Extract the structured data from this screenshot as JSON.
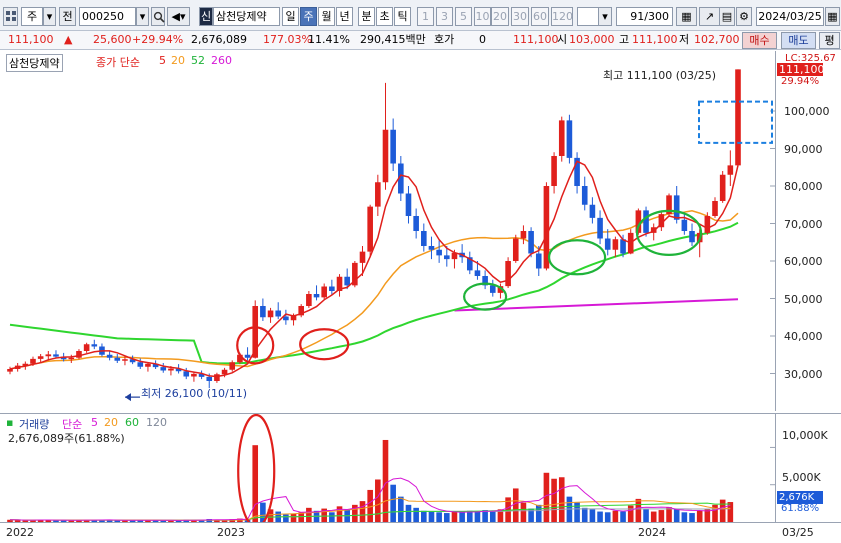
{
  "toolbar": {
    "period_mode": "주",
    "all_mark": "전",
    "code": "000250",
    "code_badge": "신",
    "stock_name": "삼천당제약",
    "intervals": [
      "일",
      "주",
      "월",
      "년",
      "분",
      "초",
      "틱"
    ],
    "selected_interval": "주",
    "ticks": [
      "1",
      "3",
      "5",
      "10",
      "20",
      "30",
      "60",
      "120"
    ],
    "count": "91",
    "total": "/300",
    "date": "2024/03/25"
  },
  "info": {
    "price": "111,100",
    "change": "25,600",
    "change_pct": "+29.94%",
    "volume": "2,676,089",
    "volume_ratio": "177.03%",
    "turnover": "11.41%",
    "amount": "290,415백만",
    "quote_label": "호가",
    "quote_value": "0",
    "last": "111,100",
    "open_label": "시",
    "open": "103,000",
    "high_label": "고",
    "high": "111,100",
    "low_label": "저",
    "low": "102,700",
    "buy_label": "매수",
    "sell_label": "매도",
    "eval_label": "평"
  },
  "price_panel": {
    "title": "삼천당제약",
    "ma_label": "종가 단순",
    "ma_periods": [
      "5",
      "20",
      "52",
      "260"
    ],
    "ma_colors": [
      "#e0201c",
      "#f39a1e",
      "#2fd62f",
      "#d619d6"
    ],
    "lc_label": "LC:325.67",
    "last_price_tag": "111,100",
    "last_pct_tag": "29.94%",
    "high_note": "최고 111,100 (03/25)",
    "low_note": "최저 26,100 (10/11)",
    "y_ticks": [
      "100,000",
      "90,000",
      "80,000",
      "70,000",
      "60,000",
      "50,000",
      "40,000",
      "30,000"
    ]
  },
  "volume_panel": {
    "title": "거래량",
    "ma_label": "단순",
    "ma_periods": [
      "5",
      "20",
      "60",
      "120"
    ],
    "ma_colors": [
      "#d619d6",
      "#f39a1e",
      "#2fd62f",
      "#9aa3b3"
    ],
    "value_label": "2,676,089주(61.88%)",
    "y_ticks": [
      "10,000K",
      "5,000K"
    ],
    "tag_value": "2,676K",
    "tag_pct": "61.88%"
  },
  "x_axis": {
    "labels": [
      "2022",
      "2023",
      "2024"
    ],
    "current": "03/25"
  },
  "colors": {
    "up": "#e0201c",
    "down": "#1d5bd8",
    "annotation_red": "#e0201c",
    "annotation_green": "#1fb33a",
    "annotation_blue": "#1b7fe0"
  },
  "chart_data": {
    "type": "candlestick",
    "title": "삼천당제약",
    "interval": "weekly",
    "x_labels": [
      "2022",
      "2023",
      "2024"
    ],
    "ylim": [
      24000,
      112000
    ],
    "y_ticks": [
      30000,
      40000,
      50000,
      60000,
      70000,
      80000,
      90000,
      100000
    ],
    "ohlc": [
      [
        30500,
        31800,
        29800,
        31200
      ],
      [
        31200,
        32800,
        30500,
        32100
      ],
      [
        32100,
        33200,
        31000,
        32600
      ],
      [
        32600,
        34500,
        32000,
        33900
      ],
      [
        33900,
        35200,
        33000,
        34600
      ],
      [
        34600,
        36000,
        33500,
        35100
      ],
      [
        35100,
        36200,
        34000,
        34500
      ],
      [
        34500,
        35500,
        33200,
        33800
      ],
      [
        33800,
        35000,
        32800,
        34200
      ],
      [
        34200,
        36500,
        33800,
        36000
      ],
      [
        36000,
        38200,
        35500,
        37800
      ],
      [
        37800,
        39000,
        36500,
        37200
      ],
      [
        37200,
        38000,
        34500,
        35000
      ],
      [
        35000,
        36000,
        33500,
        34200
      ],
      [
        34200,
        35200,
        32800,
        33400
      ],
      [
        33400,
        34500,
        32200,
        33800
      ],
      [
        33800,
        34800,
        32500,
        33000
      ],
      [
        33000,
        34000,
        31200,
        31800
      ],
      [
        31800,
        33000,
        30500,
        32600
      ],
      [
        32600,
        33500,
        31200,
        31700
      ],
      [
        31700,
        32800,
        30200,
        30800
      ],
      [
        30800,
        32000,
        29500,
        31300
      ],
      [
        31300,
        32500,
        30000,
        30600
      ],
      [
        30600,
        31500,
        28500,
        29200
      ],
      [
        29200,
        30500,
        27800,
        29900
      ],
      [
        29900,
        30800,
        28500,
        29100
      ],
      [
        29100,
        30000,
        26100,
        28000
      ],
      [
        28000,
        30200,
        27500,
        29800
      ],
      [
        29800,
        31500,
        29000,
        31000
      ],
      [
        31000,
        33500,
        30500,
        33000
      ],
      [
        33000,
        35500,
        32500,
        35000
      ],
      [
        35000,
        37000,
        33500,
        34200
      ],
      [
        34200,
        49500,
        34000,
        48000
      ],
      [
        48000,
        50000,
        44000,
        45000
      ],
      [
        45000,
        47500,
        43500,
        46800
      ],
      [
        46800,
        49000,
        44500,
        45200
      ],
      [
        45200,
        47000,
        43000,
        44200
      ],
      [
        44200,
        46000,
        42800,
        45500
      ],
      [
        45500,
        48500,
        45000,
        48000
      ],
      [
        48000,
        52000,
        47500,
        51200
      ],
      [
        51200,
        53500,
        49500,
        50300
      ],
      [
        50300,
        54000,
        49800,
        53200
      ],
      [
        53200,
        55000,
        51000,
        52000
      ],
      [
        52000,
        56500,
        50500,
        55800
      ],
      [
        55800,
        58000,
        52500,
        53500
      ],
      [
        53500,
        60000,
        53000,
        59500
      ],
      [
        59500,
        64000,
        56000,
        62500
      ],
      [
        62500,
        75000,
        61000,
        74500
      ],
      [
        74500,
        83000,
        72000,
        81000
      ],
      [
        81000,
        107500,
        79000,
        95000
      ],
      [
        95000,
        98000,
        84000,
        86000
      ],
      [
        86000,
        88000,
        76000,
        78000
      ],
      [
        78000,
        80000,
        70000,
        72000
      ],
      [
        72000,
        74000,
        66000,
        68000
      ],
      [
        68000,
        70000,
        62500,
        64000
      ],
      [
        64000,
        66500,
        60500,
        63000
      ],
      [
        63000,
        65500,
        59500,
        61500
      ],
      [
        61500,
        64000,
        58500,
        60500
      ],
      [
        60500,
        63000,
        58000,
        62200
      ],
      [
        62200,
        64500,
        59500,
        61000
      ],
      [
        61000,
        62500,
        56500,
        57500
      ],
      [
        57500,
        60000,
        55000,
        56000
      ],
      [
        56000,
        57500,
        52500,
        53500
      ],
      [
        53500,
        55000,
        50500,
        51500
      ],
      [
        51500,
        54000,
        50000,
        53300
      ],
      [
        53300,
        61000,
        52800,
        60000
      ],
      [
        60000,
        67000,
        59500,
        66000
      ],
      [
        66000,
        69500,
        64500,
        68000
      ],
      [
        68000,
        69000,
        61000,
        62000
      ],
      [
        62000,
        64000,
        56000,
        58000
      ],
      [
        58000,
        81000,
        57500,
        80000
      ],
      [
        80000,
        89000,
        78000,
        88000
      ],
      [
        88000,
        98500,
        86500,
        97500
      ],
      [
        97500,
        99000,
        86000,
        87500
      ],
      [
        87500,
        89000,
        78000,
        80000
      ],
      [
        80000,
        82500,
        73500,
        75000
      ],
      [
        75000,
        77000,
        70000,
        71500
      ],
      [
        71500,
        73500,
        64500,
        66000
      ],
      [
        66000,
        68500,
        61500,
        63000
      ],
      [
        63000,
        66500,
        61000,
        65800
      ],
      [
        65800,
        67000,
        61000,
        62000
      ],
      [
        62000,
        68500,
        61800,
        67500
      ],
      [
        67500,
        74000,
        67000,
        73500
      ],
      [
        73500,
        74500,
        66500,
        67500
      ],
      [
        67500,
        70000,
        65500,
        69000
      ],
      [
        69000,
        73500,
        68000,
        72500
      ],
      [
        72500,
        78000,
        72000,
        77500
      ],
      [
        77500,
        80000,
        70000,
        71000
      ],
      [
        71000,
        73000,
        67000,
        68000
      ],
      [
        68000,
        70000,
        64000,
        65000
      ],
      [
        65000,
        68500,
        61000,
        67500
      ],
      [
        67500,
        73000,
        67000,
        72000
      ],
      [
        72000,
        77000,
        71500,
        76000
      ],
      [
        76000,
        84000,
        75500,
        83000
      ],
      [
        83000,
        89500,
        80000,
        85500
      ],
      [
        85500,
        111100,
        102700,
        111100
      ]
    ],
    "volume": [
      300,
      250,
      230,
      260,
      280,
      300,
      210,
      220,
      200,
      300,
      330,
      240,
      280,
      230,
      210,
      220,
      200,
      280,
      230,
      210,
      200,
      230,
      210,
      320,
      270,
      240,
      400,
      260,
      300,
      380,
      460,
      360,
      10300,
      2600,
      1700,
      1400,
      1000,
      1100,
      1300,
      1900,
      1500,
      1800,
      1300,
      2100,
      1700,
      2300,
      2800,
      4300,
      5700,
      11000,
      5000,
      3400,
      2300,
      1900,
      1500,
      1400,
      1300,
      1200,
      1400,
      1300,
      1500,
      1400,
      1600,
      1500,
      1700,
      3300,
      4500,
      2600,
      1800,
      2300,
      6600,
      5800,
      6000,
      3400,
      2600,
      1900,
      1700,
      1400,
      1300,
      1500,
      1400,
      2200,
      3100,
      1700,
      1400,
      1600,
      2000,
      1700,
      1300,
      1200,
      1500,
      1700,
      2300,
      3000,
      2676
    ]
  }
}
